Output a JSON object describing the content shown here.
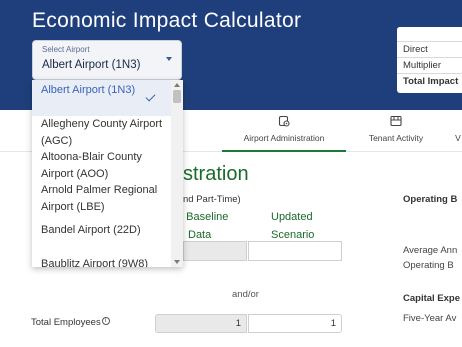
{
  "header": {
    "title": "Economic Impact Calculator"
  },
  "airport_select": {
    "label": "Select Airport",
    "value": "Albert Airport (1N3)"
  },
  "dropdown": {
    "items": [
      {
        "label": "Albert Airport (1N3)",
        "selected": true
      },
      {
        "label": "Allegheny County Airport (AGC)",
        "selected": false
      },
      {
        "label": "Altoona-Blair County Airport (AOO)",
        "selected": false
      },
      {
        "label": "Arnold Palmer Regional Airport (LBE)",
        "selected": false
      },
      {
        "label": "Bandel Airport (22D)",
        "selected": false
      },
      {
        "label": "Baublitz Airport (9W8)",
        "selected": false
      }
    ]
  },
  "impact_table": {
    "rows": [
      "Direct",
      "Multiplier",
      "Total Impact"
    ]
  },
  "tabs": [
    {
      "label": "Airport Administration",
      "icon": "gear-icon",
      "active": true
    },
    {
      "label": "Tenant Activity",
      "icon": "building-icon",
      "active": false
    },
    {
      "label": "V",
      "icon": "tab-icon",
      "active": false
    }
  ],
  "section": {
    "title": "stration",
    "col_note": "nd Part-Time)",
    "baseline_header_1": "9 Baseline",
    "baseline_header_2": "Data",
    "updated_header_1": "Updated",
    "updated_header_2": "Scenario",
    "and_or": "and/or",
    "total_employees_label": "Total Employees",
    "total_employees_baseline": "1",
    "total_employees_updated": "1"
  },
  "right_panel": {
    "operating_heading": "Operating B",
    "avg_annual": "Average Ann",
    "operating_b2": "Operating B",
    "capital_heading": "Capital Expe",
    "five_year": "Five-Year Av"
  },
  "colors": {
    "header_bg": "#1f3f7c",
    "accent_green": "#1a6a2a",
    "selected_blue": "#3c63b8"
  }
}
